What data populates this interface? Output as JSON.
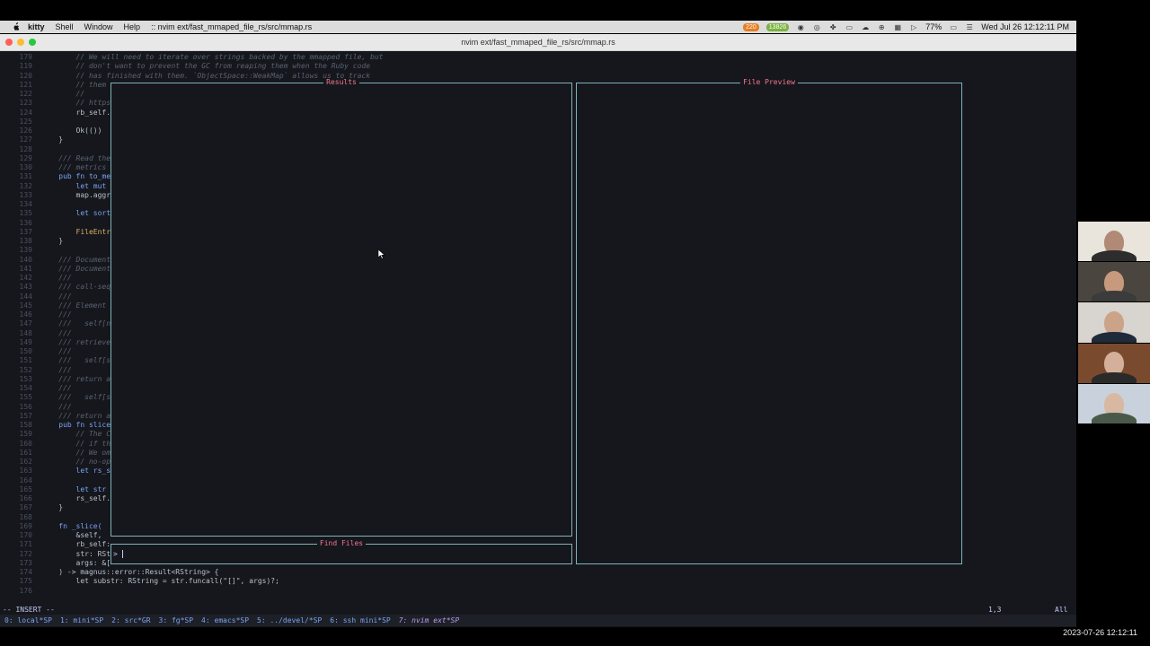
{
  "colors": {
    "accent_pink": "#f7768e",
    "panel_border": "#7fb3b8",
    "terminal_bg": "#15171c"
  },
  "menubar": {
    "app_name": "kitty",
    "items": [
      "Shell",
      "Window",
      "Help",
      ":: nvim ext/fast_mmaped_file_rs/src/mmap.rs"
    ],
    "badge_red": "220",
    "badge_green": "13826",
    "battery": "77%",
    "datetime": "Wed Jul 26  12:12:11 PM",
    "icons": [
      "apple-icon",
      "ghost-icon",
      "notification-icon",
      "puzzle-icon",
      "window-icon",
      "cloud-icon",
      "globe-icon",
      "grid-icon",
      "play-icon",
      "battery-icon",
      "control-center-icon"
    ]
  },
  "window": {
    "title": "nvim ext/fast_mmaped_file_rs/src/mmap.rs"
  },
  "editor": {
    "lines": [
      {
        "n": "179",
        "t": "        // We will need to iterate over strings backed by the mmapped file, but",
        "c": "cm"
      },
      {
        "n": "119",
        "t": "        // don't want to prevent the GC from reaping them when the Ruby code",
        "c": "cm"
      },
      {
        "n": "120",
        "t": "        // has finished with them. `ObjectSpace::WeakMap` allows us to track",
        "c": "cm"
      },
      {
        "n": "121",
        "t": "        // them",
        "c": "cm"
      },
      {
        "n": "122",
        "t": "        //",
        "c": "cm"
      },
      {
        "n": "123",
        "t": "        // https",
        "c": "cm"
      },
      {
        "n": "124",
        "t": "        rb_self.",
        "c": ""
      },
      {
        "n": "125",
        "t": "",
        "c": ""
      },
      {
        "n": "126",
        "t": "        Ok(())",
        "c": ""
      },
      {
        "n": "127",
        "t": "    }",
        "c": ""
      },
      {
        "n": "128",
        "t": "",
        "c": ""
      },
      {
        "n": "129",
        "t": "    /// Read the",
        "c": "cm"
      },
      {
        "n": "130",
        "t": "    /// metrics",
        "c": "cm"
      },
      {
        "n": "131",
        "t": "    pub fn to_me",
        "c": "kw"
      },
      {
        "n": "132",
        "t": "        let mut",
        "c": "kw"
      },
      {
        "n": "133",
        "t": "        map.aggr",
        "c": ""
      },
      {
        "n": "134",
        "t": "",
        "c": ""
      },
      {
        "n": "135",
        "t": "        let sort",
        "c": "kw"
      },
      {
        "n": "136",
        "t": "",
        "c": ""
      },
      {
        "n": "137",
        "t": "        FileEntr",
        "c": "ty"
      },
      {
        "n": "138",
        "t": "    }",
        "c": ""
      },
      {
        "n": "139",
        "t": "",
        "c": ""
      },
      {
        "n": "140",
        "t": "    /// Document",
        "c": "cm"
      },
      {
        "n": "141",
        "t": "    /// Document",
        "c": "cm"
      },
      {
        "n": "142",
        "t": "    ///",
        "c": "cm"
      },
      {
        "n": "143",
        "t": "    /// call-seq",
        "c": "cm"
      },
      {
        "n": "144",
        "t": "    ///",
        "c": "cm"
      },
      {
        "n": "145",
        "t": "    /// Element",
        "c": "cm"
      },
      {
        "n": "146",
        "t": "    ///",
        "c": "cm"
      },
      {
        "n": "147",
        "t": "    ///   self[n",
        "c": "cm"
      },
      {
        "n": "148",
        "t": "    ///",
        "c": "cm"
      },
      {
        "n": "149",
        "t": "    /// retrieve",
        "c": "cm"
      },
      {
        "n": "150",
        "t": "    ///",
        "c": "cm"
      },
      {
        "n": "151",
        "t": "    ///   self[s",
        "c": "cm"
      },
      {
        "n": "152",
        "t": "    ///",
        "c": "cm"
      },
      {
        "n": "153",
        "t": "    /// return a",
        "c": "cm"
      },
      {
        "n": "154",
        "t": "    ///",
        "c": "cm"
      },
      {
        "n": "155",
        "t": "    ///   self[s",
        "c": "cm"
      },
      {
        "n": "156",
        "t": "    ///",
        "c": "cm"
      },
      {
        "n": "157",
        "t": "    /// return a",
        "c": "cm"
      },
      {
        "n": "158",
        "t": "    pub fn slice",
        "c": "kw"
      },
      {
        "n": "159",
        "t": "        // The C",
        "c": "cm"
      },
      {
        "n": "160",
        "t": "        // if th",
        "c": "cm"
      },
      {
        "n": "161",
        "t": "        // We om",
        "c": "cm"
      },
      {
        "n": "162",
        "t": "        // no-op",
        "c": "cm"
      },
      {
        "n": "163",
        "t": "        let rs_s",
        "c": "kw"
      },
      {
        "n": "164",
        "t": "",
        "c": ""
      },
      {
        "n": "165",
        "t": "        let str",
        "c": "kw"
      },
      {
        "n": "166",
        "t": "        rs_self.",
        "c": ""
      },
      {
        "n": "167",
        "t": "    }",
        "c": ""
      },
      {
        "n": "168",
        "t": "",
        "c": ""
      },
      {
        "n": "169",
        "t": "    fn _slice(",
        "c": "kw"
      },
      {
        "n": "170",
        "t": "        &self,",
        "c": ""
      },
      {
        "n": "171",
        "t": "        rb_self:",
        "c": ""
      },
      {
        "n": "172",
        "t": "        str: RSt",
        "c": ""
      },
      {
        "n": "173",
        "t": "        args: &[",
        "c": ""
      },
      {
        "n": "174",
        "t": "    ) -> magnus::error::Result<RString> {",
        "c": ""
      },
      {
        "n": "175",
        "t": "        let substr: RString = str.funcall(\"[]\", args)?;",
        "c": ""
      },
      {
        "n": "176",
        "t": "",
        "c": ""
      }
    ]
  },
  "telescope": {
    "results_title": "Results",
    "preview_title": "File Preview",
    "prompt_title": "Find Files",
    "prompt_prefix": ">",
    "prompt_value": ""
  },
  "statusline": {
    "mode": "-- INSERT --",
    "position": "1,3",
    "scroll": "All"
  },
  "tmux_tabs": [
    {
      "label": "0: local*SP",
      "active": false
    },
    {
      "label": "1: mini*SP",
      "active": false
    },
    {
      "label": "2: src*GR",
      "active": false
    },
    {
      "label": "3: fg*SP",
      "active": false
    },
    {
      "label": "4: emacs*SP",
      "active": false
    },
    {
      "label": "5: ../devel/*SP",
      "active": false
    },
    {
      "label": "6: ssh mini*SP",
      "active": false
    },
    {
      "label": "7: nvim ext*SP",
      "active": true
    }
  ],
  "video_timestamp": "2023-07-26 12:12:11"
}
